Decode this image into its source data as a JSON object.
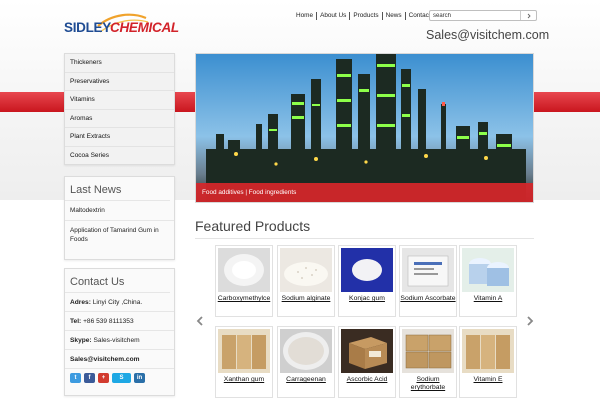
{
  "brand": {
    "word1": "SIDLEY",
    "word2": "CHEMICAL"
  },
  "nav": [
    "Home",
    "About Us",
    "Products",
    "News",
    "Contact Us"
  ],
  "search": {
    "placeholder": "search"
  },
  "header_email": "Sales@visitchem.com",
  "categories": [
    "Thickeners",
    "Preservatives",
    "Vitamins",
    "Aromas",
    "Plant Extracts",
    "Cocoa Series"
  ],
  "banner": {
    "caption": "Food additives | Food ingredients"
  },
  "last_news": {
    "title": "Last News",
    "items": [
      "Maltodextrin",
      "Application of Tamarind Gum in Foods"
    ]
  },
  "contact": {
    "title": "Contact Us",
    "address_label": "Adres:",
    "address_value": "Linyi City ,China.",
    "tel_label": "Tel:",
    "tel_value": "+86 539 8111353",
    "skype_label": "Skype:",
    "skype_value": "Sales-visitchem",
    "email": "Sales@visitchem.com"
  },
  "socials": [
    {
      "icon": "twitter-icon",
      "glyph": "t",
      "color": "#3d9be0"
    },
    {
      "icon": "facebook-icon",
      "glyph": "f",
      "color": "#3b5a98"
    },
    {
      "icon": "share-icon",
      "glyph": "+",
      "color": "#d23b2f"
    },
    {
      "icon": "skype-icon",
      "glyph": "S",
      "color": "#1ea8e4"
    },
    {
      "icon": "linkedin-icon",
      "glyph": "in",
      "color": "#2a6fa8"
    }
  ],
  "featured": {
    "title": "Featured Products",
    "products": [
      {
        "name": "Carboxymethylce",
        "img": "white-powder"
      },
      {
        "name": "Sodium alginate",
        "img": "granules"
      },
      {
        "name": "Konjac gum",
        "img": "blue-dish"
      },
      {
        "name": "Sodium Ascorbate",
        "img": "bag"
      },
      {
        "name": "Vitamin A",
        "img": "drums"
      },
      {
        "name": "Xanthan gum",
        "img": "boxes"
      },
      {
        "name": "Carrageenan",
        "img": "plate"
      },
      {
        "name": "Ascorbic Acid",
        "img": "carton"
      },
      {
        "name": "Sodium erythorbate",
        "img": "carton-stack"
      },
      {
        "name": "Vitamin E",
        "img": "boxes"
      }
    ]
  },
  "colors": {
    "accent_red": "#d2232a",
    "brand_blue": "#1f4c93"
  }
}
